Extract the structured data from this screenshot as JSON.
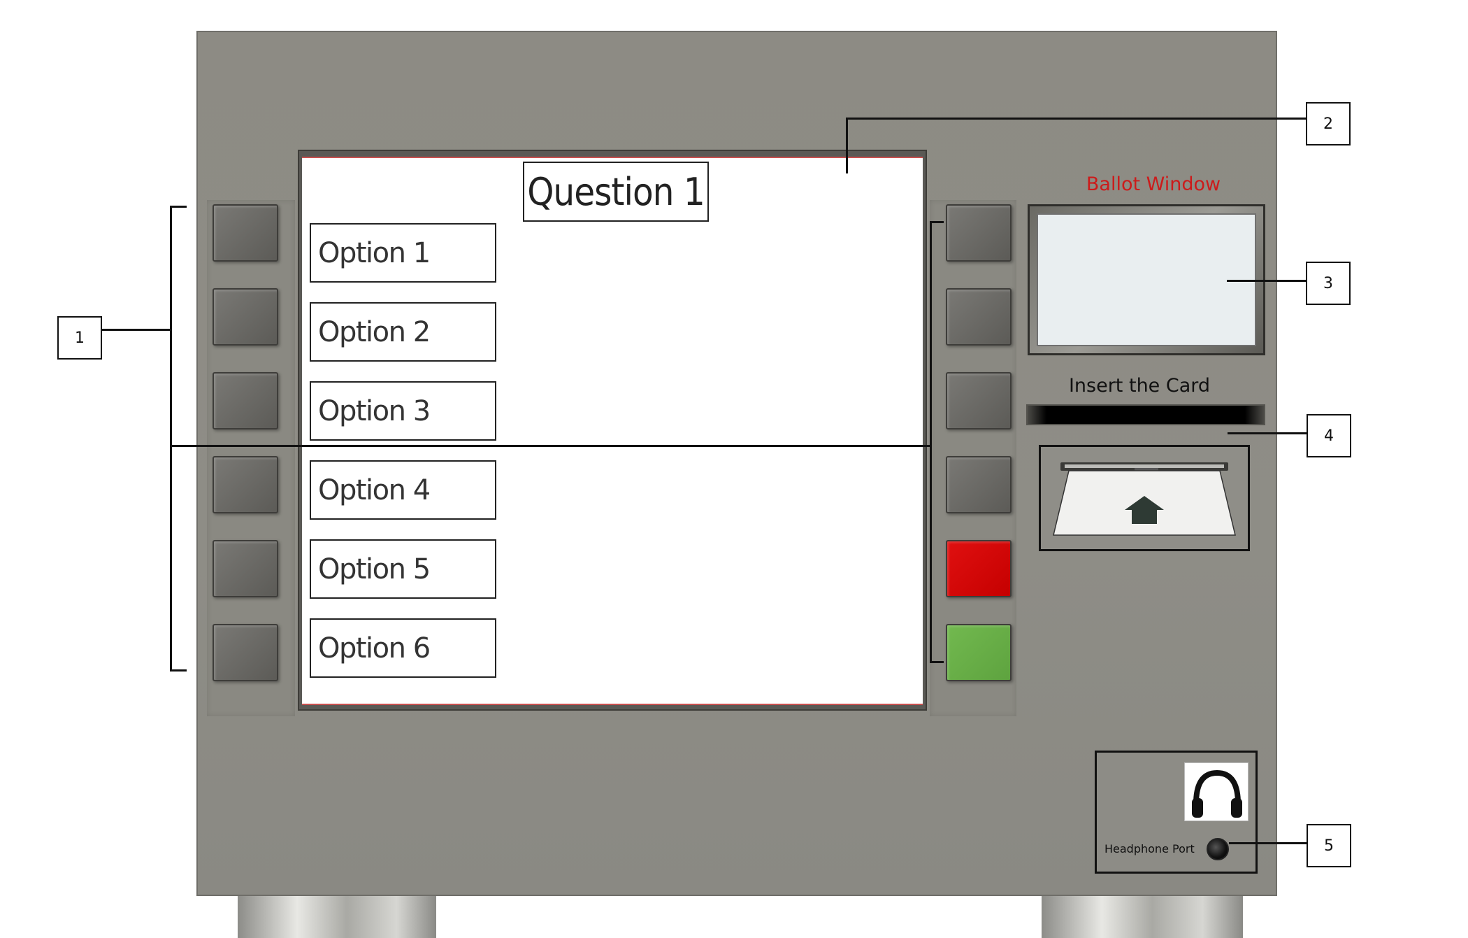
{
  "screen": {
    "question_title": "Question 1",
    "options": [
      {
        "label": "Option 1"
      },
      {
        "label": "Option 2"
      },
      {
        "label": "Option 3"
      },
      {
        "label": "Option 4"
      },
      {
        "label": "Option 5"
      },
      {
        "label": "Option 6"
      }
    ]
  },
  "right_buttons": {
    "colors": [
      "#6b6a66",
      "#6b6a66",
      "#6b6a66",
      "#6b6a66",
      "#d40000",
      "#68ad47"
    ]
  },
  "ballot_window": {
    "label": "Ballot Window"
  },
  "card_reader": {
    "label": "Insert the Card"
  },
  "headphone": {
    "label": "Headphone Port",
    "icon": "headphones-icon"
  },
  "callouts": [
    "1",
    "2",
    "3",
    "4",
    "5"
  ],
  "colors": {
    "machine_body": "#8d8b84",
    "ballot_label": "#cc1b1b",
    "cancel_button": "#d40000",
    "confirm_button": "#68ad47"
  }
}
